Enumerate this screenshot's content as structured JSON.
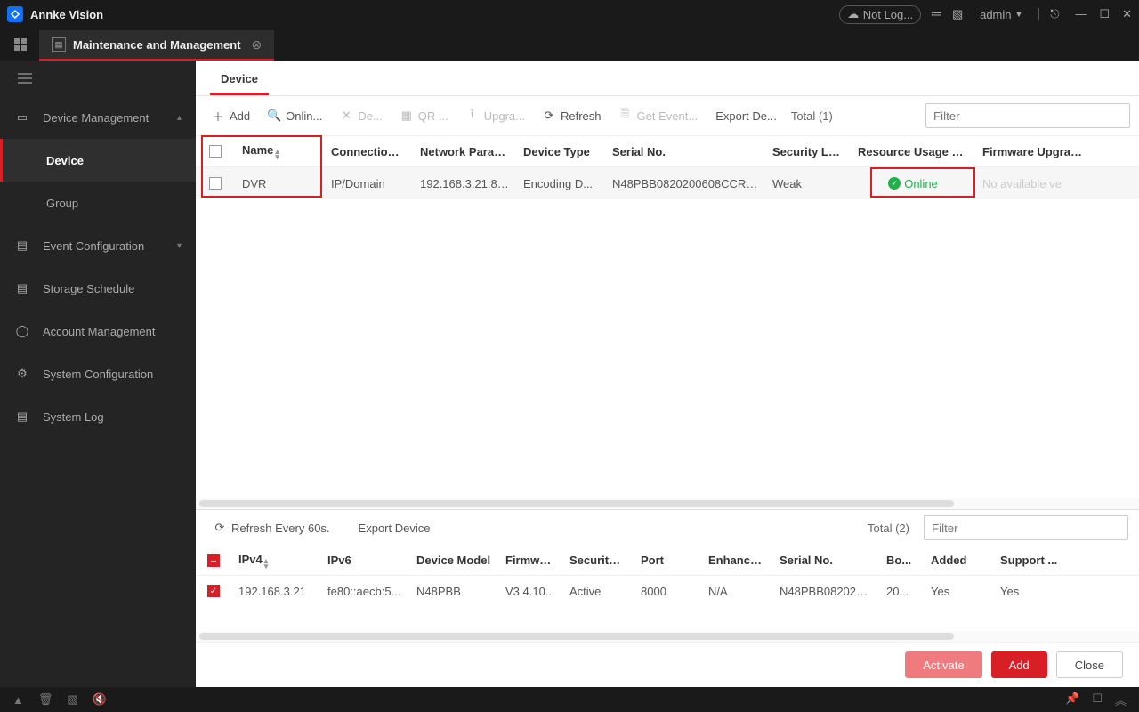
{
  "app": {
    "title": "Annke Vision"
  },
  "titlebar": {
    "notlog": "Not Log...",
    "user": "admin"
  },
  "tab": {
    "title": "Maintenance and Management"
  },
  "sidebar": {
    "items": [
      {
        "label": "Device Management"
      },
      {
        "label": "Device"
      },
      {
        "label": "Group"
      },
      {
        "label": "Event Configuration"
      },
      {
        "label": "Storage Schedule"
      },
      {
        "label": "Account Management"
      },
      {
        "label": "System Configuration"
      },
      {
        "label": "System Log"
      }
    ]
  },
  "page": {
    "tab": "Device"
  },
  "toolbar": {
    "add": "Add",
    "online": "Onlin...",
    "delete": "De...",
    "qr": "QR ...",
    "upgrade": "Upgra...",
    "refresh": "Refresh",
    "events": "Get Event...",
    "export": "Export De...",
    "total": "Total (1)",
    "filter_ph": "Filter"
  },
  "table": {
    "headers": {
      "name": "Name",
      "conn": "Connection T...",
      "net": "Network Param...",
      "type": "Device Type",
      "serial": "Serial No.",
      "sec": "Security Level",
      "res": "Resource Usage Status",
      "fw": "Firmware Upgrade"
    },
    "rows": [
      {
        "name": "DVR",
        "conn": "IP/Domain",
        "net": "192.168.3.21:80...",
        "type": "Encoding D...",
        "serial": "N48PBB0820200608CCRR...",
        "sec": "Weak",
        "res": "Online",
        "fw": "No available ve"
      }
    ]
  },
  "panel2": {
    "refresh": "Refresh Every 60s.",
    "export": "Export Device",
    "total": "Total (2)",
    "filter_ph": "Filter",
    "headers": {
      "ip4": "IPv4",
      "ip6": "IPv6",
      "model": "Device Model",
      "fw": "Firmwar...",
      "sec": "Security ...",
      "port": "Port",
      "enh": "Enhance...",
      "ser": "Serial No.",
      "boot": "Bo...",
      "added": "Added",
      "sup": "Support ..."
    },
    "rows": [
      {
        "ip4": "192.168.3.21",
        "ip6": "fe80::aecb:5...",
        "model": "N48PBB",
        "fw": "V3.4.10...",
        "sec": "Active",
        "port": "8000",
        "enh": "N/A",
        "ser": "N48PBB082020...",
        "boot": "20...",
        "added": "Yes",
        "sup": "Yes"
      }
    ]
  },
  "buttons": {
    "activate": "Activate",
    "add": "Add",
    "close": "Close"
  }
}
